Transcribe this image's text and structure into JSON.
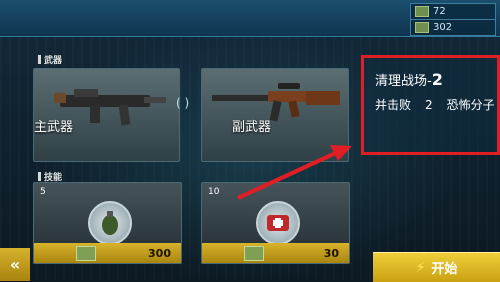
{
  "resources": [
    {
      "value": "72",
      "icon": "ammo-box-icon"
    },
    {
      "value": "302",
      "icon": "cash-stack-icon"
    }
  ],
  "weapons": {
    "section_label": "武器",
    "primary_label": "主武器",
    "secondary_label": "副武器",
    "swap_symbol": "( )"
  },
  "skills": {
    "section_label": "技能",
    "items": [
      {
        "count": "5",
        "icon": "grenade-icon",
        "cost": "300"
      },
      {
        "count": "10",
        "icon": "medkit-icon",
        "cost": "30"
      }
    ]
  },
  "mission": {
    "title": "清理战场-",
    "stage": "2",
    "objective_prefix": "并击败",
    "objective_count": "2",
    "objective_suffix": "恐怖分子"
  },
  "controls": {
    "back_symbol": "«",
    "start_label": "开始",
    "start_icon": "lightning-icon"
  },
  "colors": {
    "accent_yellow": "#d7b22a",
    "highlight_red": "#e01f25",
    "topbar_blue": "#1b4e6e"
  }
}
